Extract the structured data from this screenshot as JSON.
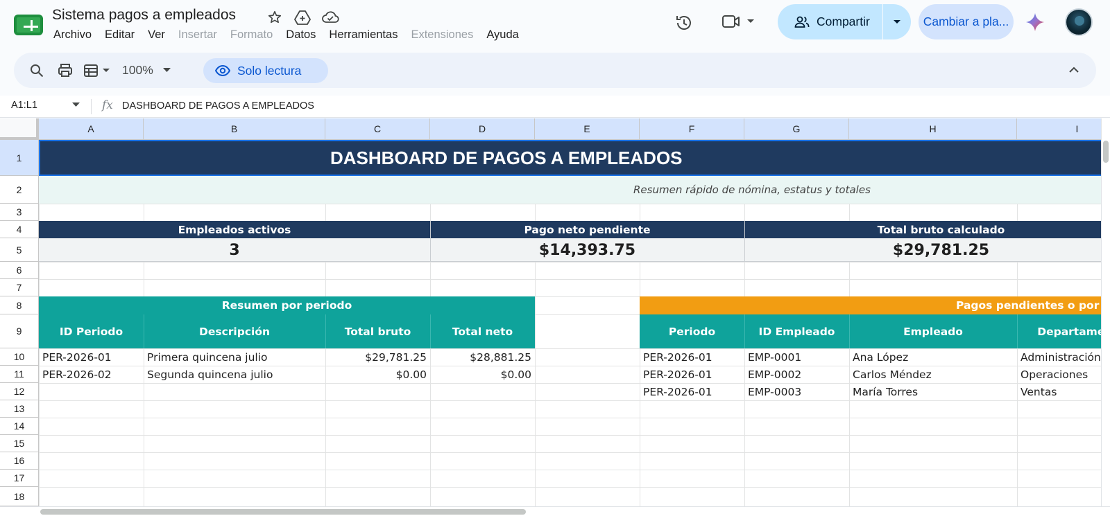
{
  "app": {
    "doc_title": "Sistema pagos a empleados",
    "menu": [
      {
        "label": "Archivo",
        "enabled": true
      },
      {
        "label": "Editar",
        "enabled": true
      },
      {
        "label": "Ver",
        "enabled": true
      },
      {
        "label": "Insertar",
        "enabled": false
      },
      {
        "label": "Formato",
        "enabled": false
      },
      {
        "label": "Datos",
        "enabled": true
      },
      {
        "label": "Herramientas",
        "enabled": true
      },
      {
        "label": "Extensiones",
        "enabled": false
      },
      {
        "label": "Ayuda",
        "enabled": true
      }
    ],
    "share_label": "Compartir",
    "switch_label": "Cambiar a pla...",
    "icons": [
      "sheets-logo-icon",
      "star-icon",
      "move-to-drive-icon",
      "cloud-saved-icon",
      "version-history-icon",
      "meet-video-icon",
      "people-icon",
      "gemini-icon"
    ]
  },
  "toolbar": {
    "zoom": "100%",
    "readonly_label": "Solo lectura",
    "icons": [
      "search-icon",
      "print-icon",
      "format-table-icon",
      "eye-icon",
      "collapse-chevron-icon"
    ]
  },
  "formula_bar": {
    "name_box": "A1:L1",
    "fx_label": "fx",
    "content": "DASHBOARD DE PAGOS A EMPLEADOS"
  },
  "columns": [
    "A",
    "B",
    "C",
    "D",
    "E",
    "F",
    "G",
    "H",
    "I"
  ],
  "rows": [
    "1",
    "2",
    "3",
    "4",
    "5",
    "6",
    "7",
    "8",
    "9",
    "10",
    "11",
    "12",
    "13",
    "14",
    "15",
    "16",
    "17",
    "18"
  ],
  "sheet": {
    "title": "DASHBOARD DE PAGOS A EMPLEADOS",
    "subtitle": "Resumen rápido de nómina, estatus y totales",
    "kpis": [
      {
        "label": "Empleados activos",
        "value": "3"
      },
      {
        "label": "Pago neto pendiente",
        "value": "$14,393.75"
      },
      {
        "label": "Total bruto calculado",
        "value": "$29,781.25"
      }
    ],
    "period_summary": {
      "title": "Resumen por periodo",
      "headers": [
        "ID Periodo",
        "Descripción",
        "Total bruto",
        "Total neto"
      ],
      "rows": [
        [
          "PER-2026-01",
          "Primera quincena julio",
          "$29,781.25",
          "$28,881.25"
        ],
        [
          "PER-2026-02",
          "Segunda quincena julio",
          "$0.00",
          "$0.00"
        ]
      ]
    },
    "pending": {
      "title": "Pagos pendientes o por rev",
      "headers": [
        "Periodo",
        "ID Empleado",
        "Empleado",
        "Departament"
      ],
      "rows": [
        [
          "PER-2026-01",
          "EMP-0001",
          "Ana López",
          "Administración"
        ],
        [
          "PER-2026-01",
          "EMP-0002",
          "Carlos Méndez",
          "Operaciones"
        ],
        [
          "PER-2026-01",
          "EMP-0003",
          "María Torres",
          "Ventas"
        ]
      ]
    },
    "colors": {
      "navy": "#1f3a5f",
      "teal": "#0fa39b",
      "orange": "#f29d12",
      "mint": "#eaf6f4",
      "kpi_value_bg": "#f1f3f4"
    }
  }
}
